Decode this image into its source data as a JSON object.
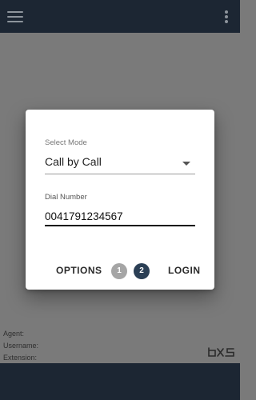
{
  "appbar": {
    "menu_icon": "hamburger-menu-icon",
    "more_icon": "more-vert-icon",
    "color": "#1c2633"
  },
  "dialog": {
    "select_mode": {
      "label": "Select Mode",
      "value": "Call by Call"
    },
    "dial_number": {
      "label": "Dial Number",
      "value": "0041791234567"
    },
    "options_label": "OPTIONS",
    "login_label": "LOGIN",
    "steps": [
      "1",
      "2"
    ],
    "active_step": "2"
  },
  "footer": {
    "agent_label": "Agent:",
    "username_label": "Username:",
    "extension_label": "Extension:",
    "logo_icon": "brand-logo-icon"
  },
  "colors": {
    "backdrop": "#7a7a7a",
    "dark_bar": "#1c2633",
    "active_step": "#2b3f55",
    "inactive_step": "#a5a5a5"
  }
}
